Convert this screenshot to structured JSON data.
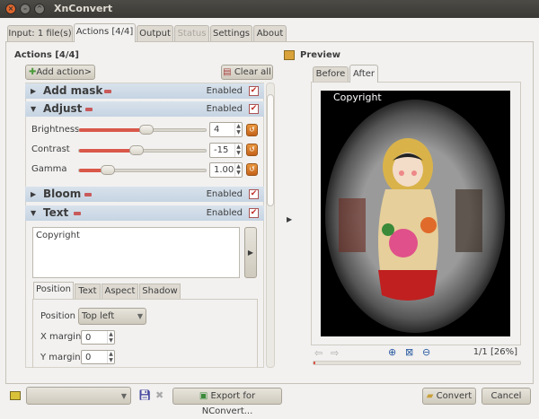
{
  "window": {
    "title": "XnConvert"
  },
  "tabs": [
    {
      "label": "Input: 1 file(s)"
    },
    {
      "label": "Actions [4/4]",
      "active": true
    },
    {
      "label": "Output"
    },
    {
      "label": "Status",
      "disabled": true
    },
    {
      "label": "Settings"
    },
    {
      "label": "About"
    }
  ],
  "actions": {
    "title": "Actions [4/4]",
    "add_label": "Add action>",
    "clear_label": "Clear all",
    "enabled_label": "Enabled",
    "items": [
      {
        "name": "Add mask",
        "expanded": false,
        "enabled": true
      },
      {
        "name": "Adjust",
        "expanded": true,
        "enabled": true,
        "params": [
          {
            "label": "Brightness",
            "value": "4",
            "slider_fraction": 0.52
          },
          {
            "label": "Contrast",
            "value": "-15",
            "slider_fraction": 0.43
          },
          {
            "label": "Gamma",
            "value": "1.00",
            "slider_fraction": 0.2
          }
        ]
      },
      {
        "name": "Bloom",
        "expanded": false,
        "enabled": true
      },
      {
        "name": "Text",
        "expanded": true,
        "enabled": true,
        "text_value": "Copyright",
        "subtabs": [
          "Position",
          "Text",
          "Aspect",
          "Shadow"
        ],
        "position_label": "Position",
        "position_value": "Top left",
        "x_margin_label": "X margin",
        "x_margin_value": "0",
        "y_margin_label": "Y margin",
        "y_margin_value": "0"
      }
    ]
  },
  "preview": {
    "title": "Preview",
    "tabs": [
      "Before",
      "After"
    ],
    "active_tab": "After",
    "overlay_text": "Copyright",
    "page_info": "1/1 [26%]",
    "progress_fraction": 0.01
  },
  "bottom": {
    "export_label": "Export for NConvert...",
    "convert_label": "Convert",
    "cancel_label": "Cancel",
    "preset_value": ""
  },
  "colors": {
    "accent": "#d9584a",
    "header": "#c6d4e2",
    "titlebar": "#3c3b37"
  }
}
